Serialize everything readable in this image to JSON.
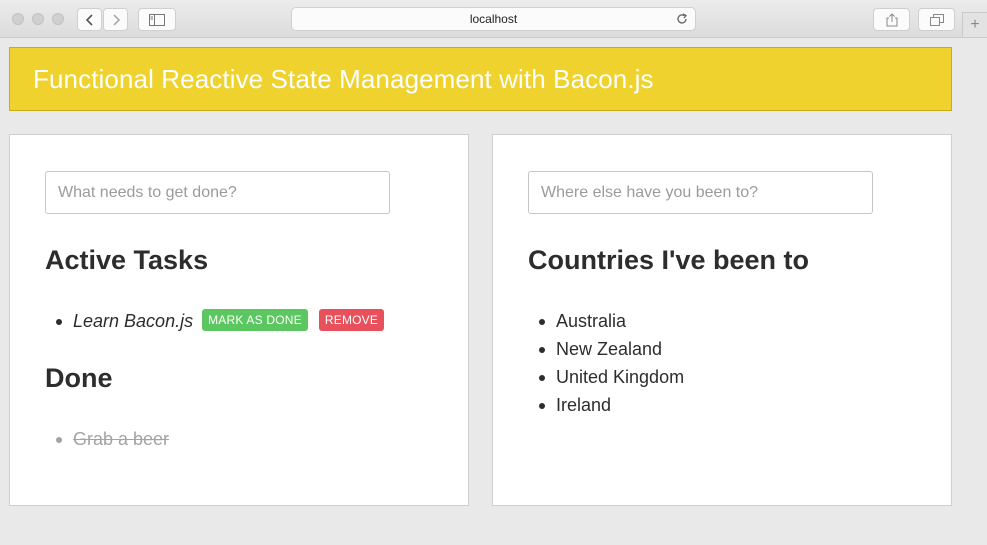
{
  "browser": {
    "url": "localhost"
  },
  "header": {
    "title": "Functional Reactive State Management with Bacon.js"
  },
  "todos": {
    "input_placeholder": "What needs to get done?",
    "active_heading": "Active Tasks",
    "active": [
      {
        "text": "Learn Bacon.js",
        "mark_done_label": "MARK AS DONE",
        "remove_label": "REMOVE"
      }
    ],
    "done_heading": "Done",
    "done": [
      {
        "text": "Grab a beer"
      }
    ]
  },
  "countries": {
    "input_placeholder": "Where else have you been to?",
    "heading": "Countries I've been to",
    "items": [
      "Australia",
      "New Zealand",
      "United Kingdom",
      "Ireland"
    ]
  },
  "colors": {
    "header_bg": "#f0d22e",
    "mark_done": "#5cc660",
    "remove": "#e8505b"
  }
}
